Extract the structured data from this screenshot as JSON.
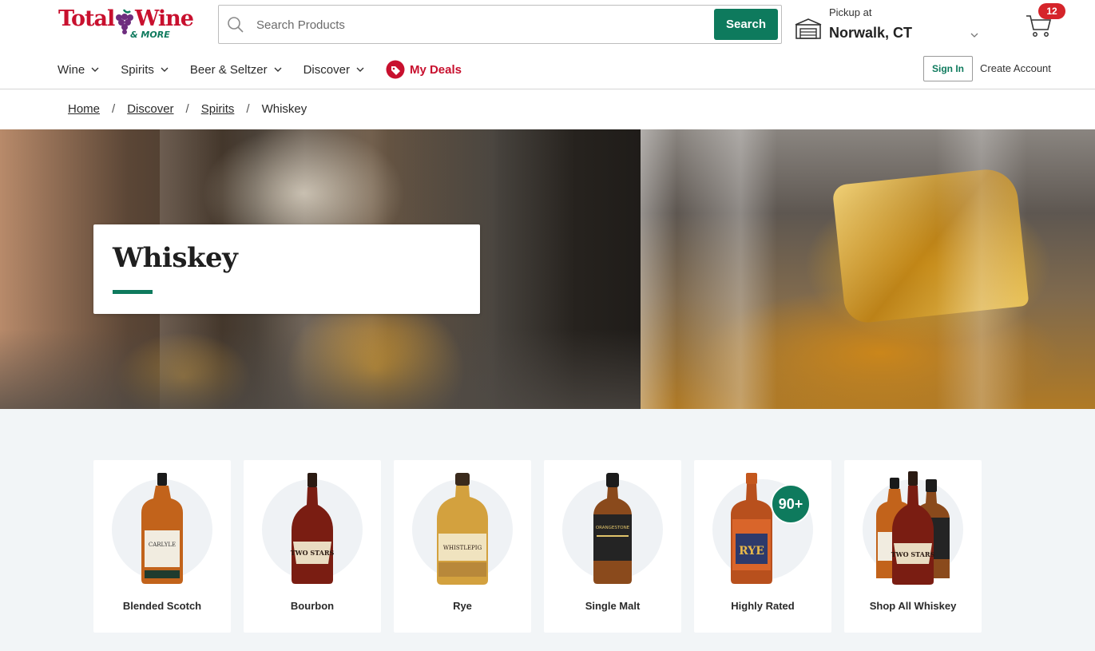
{
  "brand": {
    "name_part1": "Total",
    "name_part2": "Wine",
    "tagline": "& MORE",
    "primary_color": "#c8102e",
    "accent_color": "#0e7a5d"
  },
  "search": {
    "placeholder": "Search Products",
    "button_label": "Search"
  },
  "store": {
    "pickup_label": "Pickup at",
    "name": "Norwalk, CT"
  },
  "cart": {
    "count": "12"
  },
  "nav": {
    "items": [
      {
        "label": "Wine"
      },
      {
        "label": "Spirits"
      },
      {
        "label": "Beer & Seltzer"
      },
      {
        "label": "Discover"
      }
    ],
    "deals_label": "My Deals"
  },
  "account": {
    "sign_in": "Sign In",
    "create_account": "Create Account"
  },
  "breadcrumb": [
    {
      "label": "Home"
    },
    {
      "label": "Discover"
    },
    {
      "label": "Spirits"
    },
    {
      "label": "Whiskey"
    }
  ],
  "hero": {
    "title": "Whiskey"
  },
  "categories": [
    {
      "label": "Blended Scotch",
      "bottle_label": "CARLYLE"
    },
    {
      "label": "Bourbon",
      "bottle_label": "TWO STARS"
    },
    {
      "label": "Rye",
      "bottle_label": "WHISTLEPIG"
    },
    {
      "label": "Single Malt",
      "bottle_label": "ORANGESTONE"
    },
    {
      "label": "Highly Rated",
      "bottle_label": "RYE",
      "badge": "90+"
    },
    {
      "label": "Shop All Whiskey",
      "bottle_label": "TWO STARS"
    }
  ]
}
